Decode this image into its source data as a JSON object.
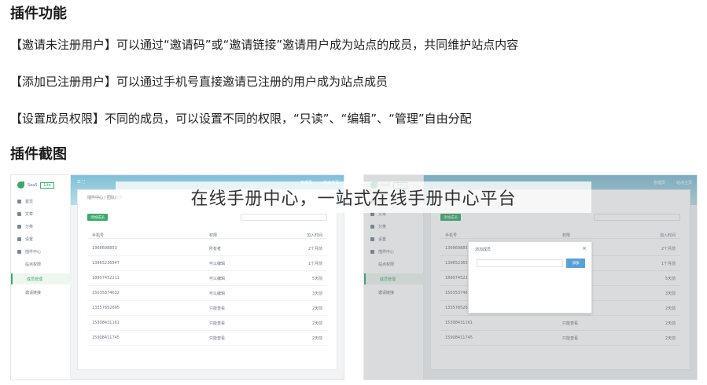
{
  "headings": {
    "features": "插件功能",
    "screenshots": "插件截图"
  },
  "features": [
    "【邀请未注册用户】可以通过“邀请码”或“邀请链接”邀请用户成为站点的成员，共同维护站点内容",
    "【添加已注册用户】可以通过手机号直接邀请已注册的用户成为站点成员",
    "【设置成员权限】不同的成员，可以设置不同的权限，“只读”、“编辑”、“管理”自由分配"
  ],
  "watermark": "在线手册中心，一站式在线手册中心平台",
  "shot_common": {
    "logo_text": "SaaS",
    "logo_tag": "Lite",
    "menu": [
      "首页",
      "文章",
      "分类",
      "设置",
      "插件中心",
      "站点权限",
      "成员管理",
      "邀请链接"
    ],
    "breadcrumb": "插件中心 / 团队成员",
    "top_right": [
      "管理员",
      "站点主页"
    ],
    "button": "添加成员",
    "header_cols": [
      "手机号",
      "权限",
      "加入时间"
    ],
    "rows": [
      {
        "phone": "1366698853",
        "role": "所有者",
        "time": "2个月前"
      },
      {
        "phone": "13965236547",
        "role": "可以编辑",
        "time": "1个月前"
      },
      {
        "phone": "18907452211",
        "role": "可以编辑",
        "time": "5天前"
      },
      {
        "phone": "15035374632",
        "role": "可以编辑",
        "time": "3天前"
      },
      {
        "phone": "13357852695",
        "role": "只能查看",
        "time": "2天前"
      },
      {
        "phone": "15308431161",
        "role": "只能查看",
        "time": "2天前"
      },
      {
        "phone": "15908411745",
        "role": "只能查看",
        "time": "2天前"
      }
    ]
  },
  "modal": {
    "title": "添加成员",
    "button": "添加",
    "close": "×"
  },
  "colors": {
    "accent_green": "#3aa86b",
    "topbar": "#7fbfd6"
  }
}
